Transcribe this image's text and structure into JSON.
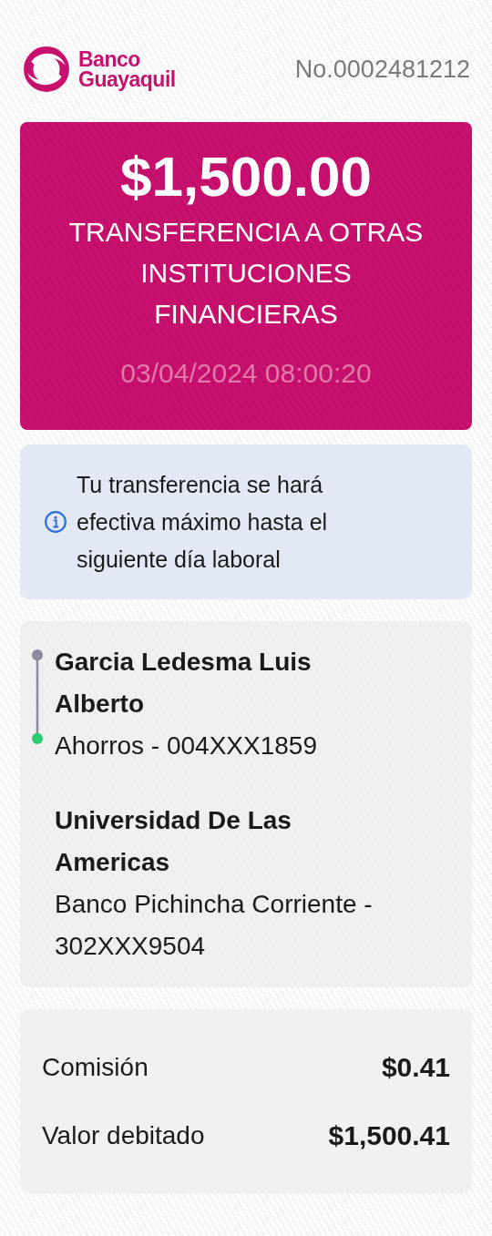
{
  "header": {
    "logo_text": "Banco Guayaquil",
    "receipt_number": "No.0002481212"
  },
  "summary": {
    "amount": "$1,500.00",
    "type": "TRANSFERENCIA A OTRAS INSTITUCIONES FINANCIERAS",
    "datetime": "03/04/2024 08:00:20"
  },
  "notice": {
    "text": "Tu transferencia se hará efectiva máximo hasta el siguiente día laboral"
  },
  "parties": [
    {
      "kind": "origin",
      "name": "Garcia Ledesma Luis Alberto",
      "account": "Ahorros - 004XXX1859"
    },
    {
      "kind": "destination",
      "name": "Universidad De Las Americas",
      "account": "Banco Pichincha Corriente - 302XXX9504"
    }
  ],
  "fees": [
    {
      "label": "Comisión",
      "value": "$0.41"
    },
    {
      "label": "Valor debitado",
      "value": "$1,500.41"
    }
  ]
}
